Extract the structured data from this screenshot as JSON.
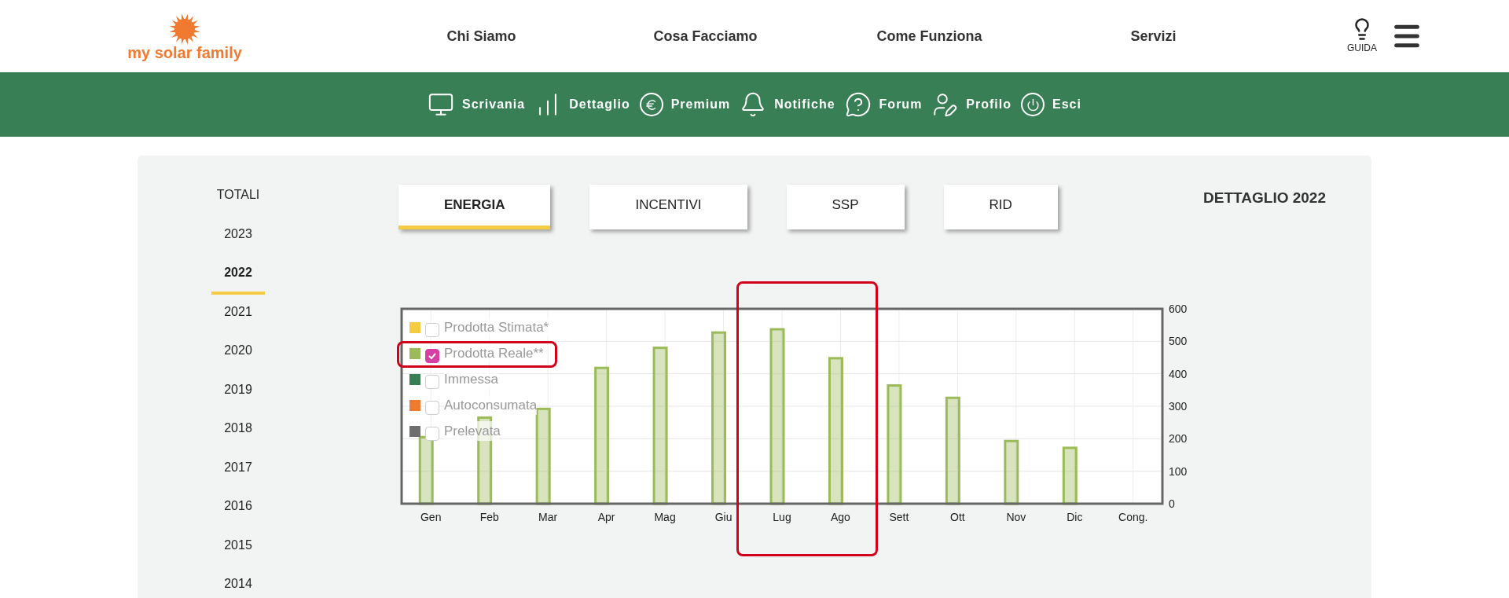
{
  "header": {
    "logo_text": "my solar family",
    "nav": [
      "Chi Siamo",
      "Cosa Facciamo",
      "Come Funziona",
      "Servizi"
    ],
    "guide_label": "GUIDA"
  },
  "toolbar": [
    {
      "label": "Scrivania"
    },
    {
      "label": "Dettaglio"
    },
    {
      "label": "Premium"
    },
    {
      "label": "Notifiche"
    },
    {
      "label": "Forum"
    },
    {
      "label": "Profilo"
    },
    {
      "label": "Esci"
    }
  ],
  "sidebar": {
    "items": [
      {
        "label": "TOTALI",
        "selected": false
      },
      {
        "label": "2023",
        "selected": false
      },
      {
        "label": "2022",
        "selected": true
      },
      {
        "label": "2021",
        "selected": false
      },
      {
        "label": "2020",
        "selected": false
      },
      {
        "label": "2019",
        "selected": false
      },
      {
        "label": "2018",
        "selected": false
      },
      {
        "label": "2017",
        "selected": false
      },
      {
        "label": "2016",
        "selected": false
      },
      {
        "label": "2015",
        "selected": false
      },
      {
        "label": "2014",
        "selected": false
      }
    ]
  },
  "tabs": [
    {
      "label": "ENERGIA",
      "selected": true
    },
    {
      "label": "INCENTIVI",
      "selected": false
    },
    {
      "label": "SSP",
      "selected": false
    },
    {
      "label": "RID",
      "selected": false
    }
  ],
  "title": "DETTAGLIO 2022",
  "chart": {
    "legend": [
      {
        "label": "Prodotta Stimata*",
        "color": "#f5cb42",
        "checked": false
      },
      {
        "color": "#9bbb59",
        "checked": true
      },
      {
        "label": "Immessa",
        "color": "#387f55",
        "checked": false
      },
      {
        "label": "Autoconsumata",
        "color": "#f07a30",
        "checked": false
      },
      {
        "label": "Prelevata",
        "color": "#6e6e6e",
        "checked": false
      }
    ],
    "chart_data": {
      "type": "bar",
      "grid": true,
      "categories": [
        "Gen",
        "Feb",
        "Mar",
        "Apr",
        "Mag",
        "Giu",
        "Lug",
        "Ago",
        "Sett",
        "Ott",
        "Nov",
        "Dic",
        "Cong."
      ],
      "series": [
        {
          "name": "Prodotta Reale**",
          "color": "#9bbb59",
          "values": [
            205,
            265,
            292,
            418,
            480,
            527,
            537,
            448,
            364,
            326,
            193,
            172,
            null
          ]
        }
      ],
      "ylim": [
        0,
        600
      ],
      "yticks": [
        0,
        100,
        200,
        300,
        400,
        500,
        600
      ]
    }
  }
}
